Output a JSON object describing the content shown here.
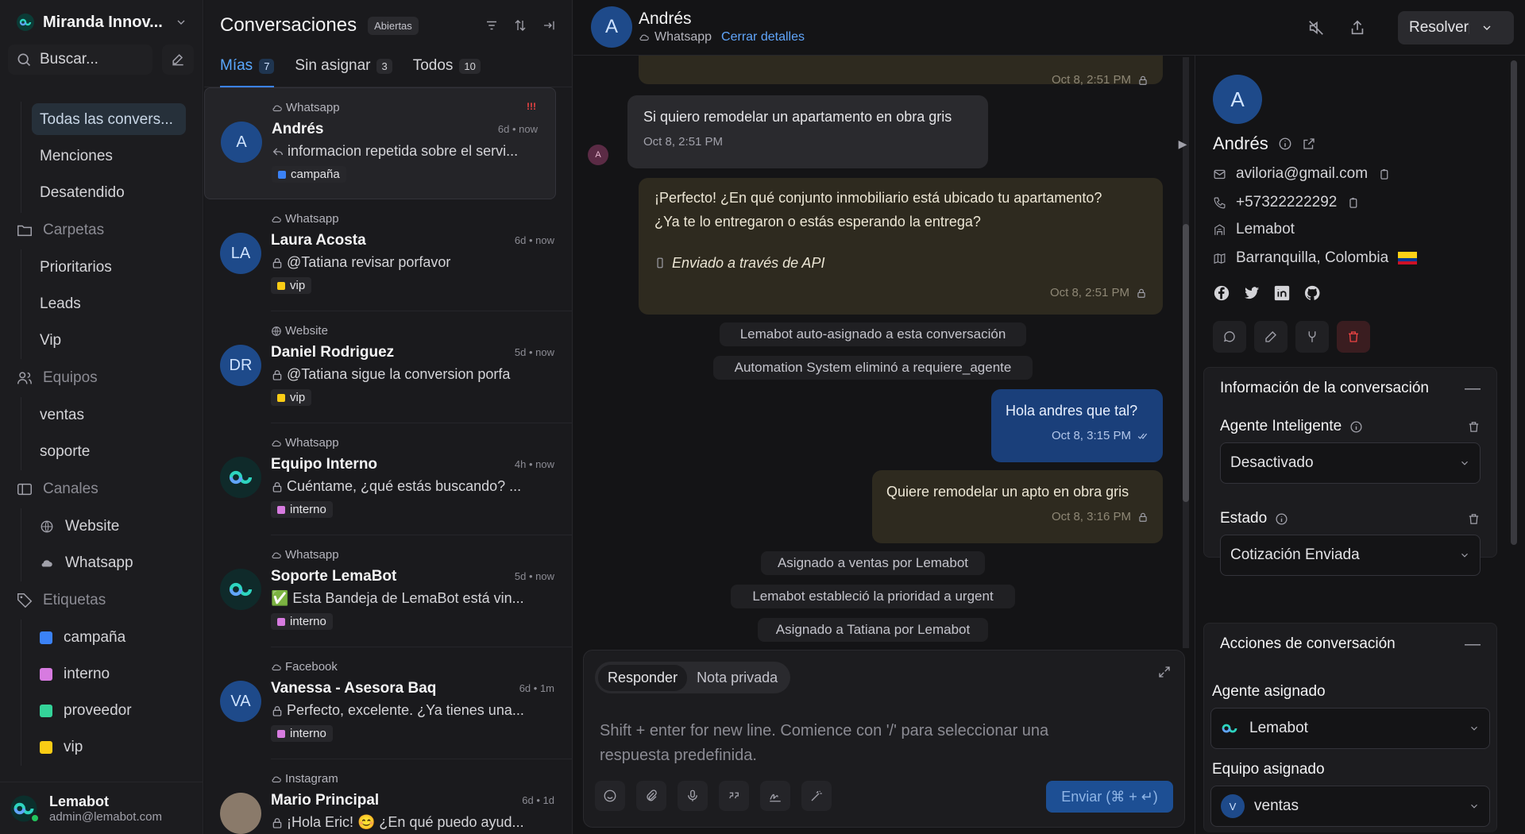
{
  "workspace": {
    "name": "Miranda Innov..."
  },
  "search": {
    "placeholder": "Buscar..."
  },
  "nav": {
    "all": "Todas las convers...",
    "mentions": "Menciones",
    "unattended": "Desatendido",
    "folders": "Carpetas",
    "folder_items": [
      "Prioritarios",
      "Leads",
      "Vip"
    ],
    "teams": "Equipos",
    "team_items": [
      "ventas",
      "soporte"
    ],
    "channels": "Canales",
    "channel_items": [
      "Website",
      "Whatsapp"
    ],
    "labels": "Etiquetas",
    "label_items": [
      {
        "name": "campaña",
        "color": "#3b82f6"
      },
      {
        "name": "interno",
        "color": "#d77be0"
      },
      {
        "name": "proveedor",
        "color": "#34d399"
      },
      {
        "name": "vip",
        "color": "#facc15"
      }
    ]
  },
  "user": {
    "name": "Lemabot",
    "email": "admin@lemabot.com"
  },
  "list": {
    "title": "Conversaciones",
    "status": "Abiertas",
    "tabs": [
      {
        "label": "Mías",
        "count": "7"
      },
      {
        "label": "Sin asignar",
        "count": "3"
      },
      {
        "label": "Todos",
        "count": "10"
      }
    ],
    "conversations": [
      {
        "channel": "Whatsapp",
        "initials": "A",
        "name": "Andrés",
        "time": "6d • now",
        "message": "informacion repetida sobre el servi...",
        "tag": "campaña",
        "tag_color": "#3b82f6",
        "avatar_color": "#1e4a8a"
      },
      {
        "channel": "Whatsapp",
        "initials": "LA",
        "name": "Laura Acosta",
        "time": "6d • now",
        "message": "@Tatiana revisar porfavor",
        "tag": "vip",
        "tag_color": "#facc15",
        "avatar_color": "#1e4a8a"
      },
      {
        "channel": "Website",
        "initials": "DR",
        "name": "Daniel Rodriguez",
        "time": "5d • now",
        "message": "@Tatiana sigue la conversion porfa",
        "tag": "vip",
        "tag_color": "#facc15",
        "avatar_color": "#1e4a8a"
      },
      {
        "channel": "Whatsapp",
        "initials": "",
        "name": "Equipo Interno",
        "time": "4h • now",
        "message": "Cuéntame, ¿qué estás buscando? ...",
        "tag": "interno",
        "tag_color": "#d77be0",
        "avatar_color": "#0f3a3a"
      },
      {
        "channel": "Whatsapp",
        "initials": "",
        "name": "Soporte LemaBot",
        "time": "5d • now",
        "message": "✅ Esta Bandeja de LemaBot está vin...",
        "tag": "interno",
        "tag_color": "#d77be0",
        "avatar_color": "#0f3a3a"
      },
      {
        "channel": "Facebook",
        "initials": "VA",
        "name": "Vanessa - Asesora Baq",
        "time": "6d • 1m",
        "message": "Perfecto, excelente. ¿Ya tienes una...",
        "tag": "interno",
        "tag_color": "#d77be0",
        "avatar_color": "#1e4a8a"
      },
      {
        "channel": "Instagram",
        "initials": "",
        "name": "Mario Principal",
        "time": "6d • 1d",
        "message": "¡Hola Eric! 😊 ¿En qué puedo ayud...",
        "tag": "",
        "tag_color": "",
        "avatar_color": "#8a7a6a"
      }
    ]
  },
  "chat": {
    "contact_initial": "A",
    "contact_name": "Andrés",
    "channel": "Whatsapp",
    "close_details": "Cerrar detalles",
    "resolve": "Resolver",
    "messages": {
      "top_ts": "Oct 8, 2:51 PM",
      "m1_text": "Si quiero remodelar un apartamento en obra gris",
      "m1_ts": "Oct 8, 2:51 PM",
      "m1_avatar": "A",
      "m2_line1": "¡Perfecto! ¿En qué conjunto inmobiliario está ubicado tu apartamento?",
      "m2_line2": "¿Ya te lo entregaron o estás esperando la entrega?",
      "m2_api": "Enviado a través de API",
      "m2_ts": "Oct 8, 2:51 PM",
      "sys1": "Lemabot auto-asignado a esta conversación",
      "sys2": "Automation System eliminó a requiere_agente",
      "m3_text": "Hola andres que tal?",
      "m3_ts": "Oct 8, 3:15 PM",
      "m4_text": "Quiere remodelar un apto en obra gris",
      "m4_ts": "Oct 8, 3:16 PM",
      "sys3": "Asignado a ventas por Lemabot",
      "sys4": "Lemabot estableció la prioridad a urgent",
      "sys5": "Asignado a Tatiana por Lemabot"
    },
    "composer": {
      "reply": "Responder",
      "private_note": "Nota privada",
      "placeholder": "Shift + enter for new line. Comience con '/' para seleccionar una respuesta predefinida.",
      "send": "Enviar (⌘ + ↵)"
    }
  },
  "contact": {
    "initial": "A",
    "name": "Andrés",
    "email": "aviloria@gmail.com",
    "phone": "+57322222292",
    "company": "Lemabot",
    "location": "Barranquilla, Colombia",
    "conv_info_title": "Información de la conversación",
    "smart_agent_label": "Agente Inteligente",
    "smart_agent_value": "Desactivado",
    "status_label": "Estado",
    "status_value": "Cotización Enviada",
    "actions_title": "Acciones de conversación",
    "assigned_agent_label": "Agente asignado",
    "assigned_agent_value": "Lemabot",
    "assigned_team_label": "Equipo asignado",
    "assigned_team_value": "ventas",
    "assigned_team_initial": "V"
  }
}
